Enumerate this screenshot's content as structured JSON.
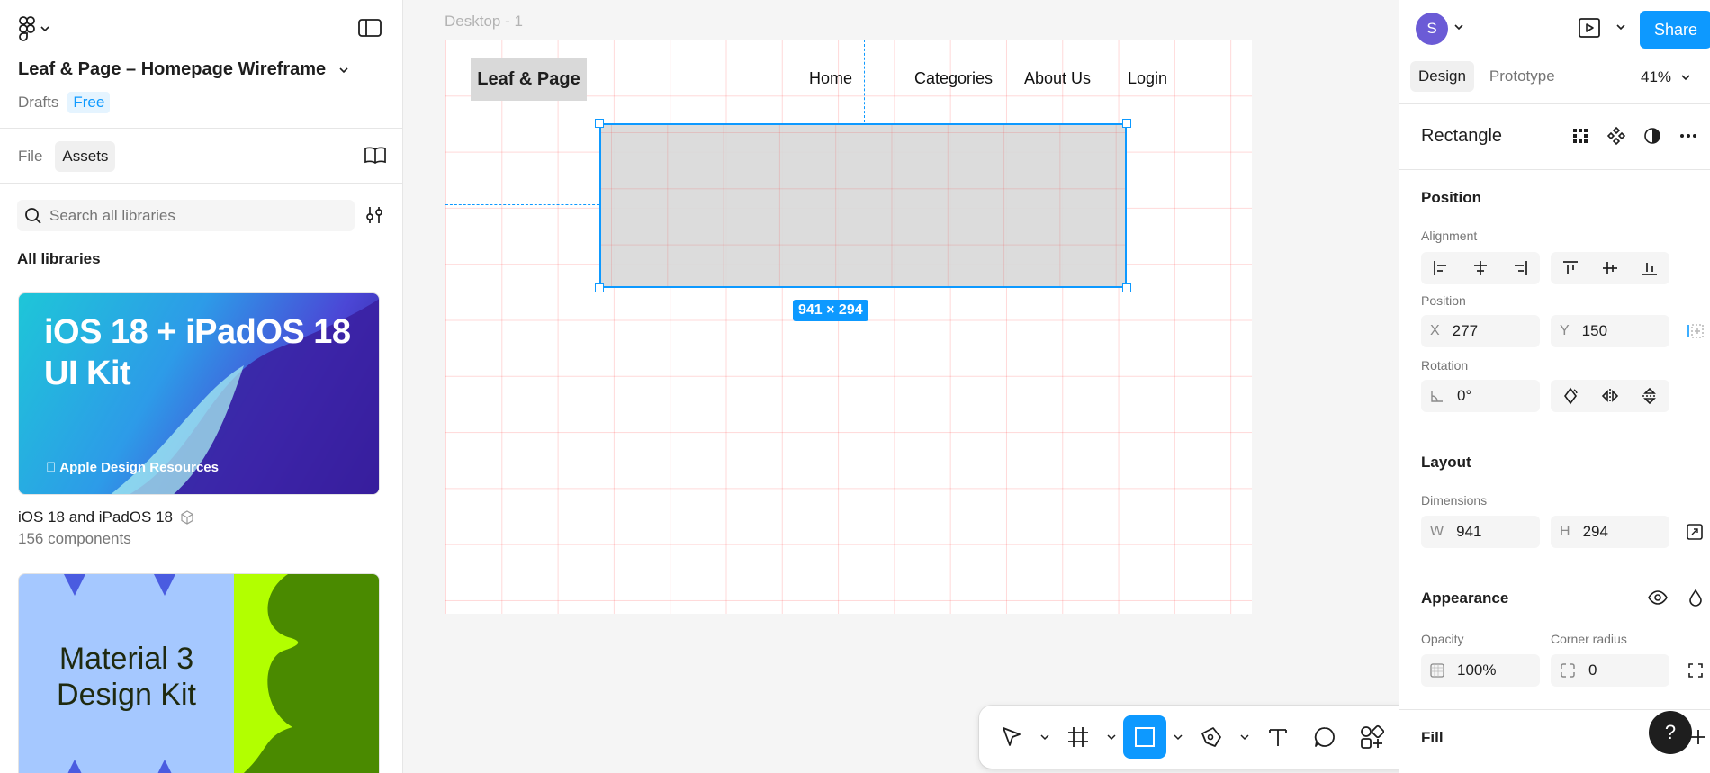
{
  "left_panel": {
    "file_title": "Leaf & Page – Homepage Wireframe",
    "drafts_label": "Drafts",
    "plan_badge": "Free",
    "tabs": [
      {
        "label": "File"
      },
      {
        "label": "Assets"
      }
    ],
    "search_placeholder": "Search all libraries",
    "all_libraries_label": "All libraries",
    "libraries": [
      {
        "thumb_title": "iOS 18 + iPadOS 18 UI Kit",
        "thumb_brand": "Apple Design Resources",
        "name": "iOS 18 and iPadOS 18",
        "count": "156 components"
      },
      {
        "thumb_title": "Material 3 Design Kit"
      }
    ]
  },
  "canvas": {
    "frame_label": "Desktop - 1",
    "brand_text": "Leaf & Page",
    "nav": [
      "Home",
      "Categories",
      "About Us",
      "Login"
    ],
    "selection_size": "941 × 294"
  },
  "toolbar": {
    "active_tool": "rectangle"
  },
  "right_panel": {
    "avatar_initial": "S",
    "share_label": "Share",
    "tabs": [
      {
        "label": "Design"
      },
      {
        "label": "Prototype"
      }
    ],
    "zoom": "41%",
    "layer_name": "Rectangle",
    "position_section": "Position",
    "alignment_label": "Alignment",
    "position_label": "Position",
    "x_label": "X",
    "x_value": "277",
    "y_label": "Y",
    "y_value": "150",
    "rotation_label": "Rotation",
    "rotation_value": "0°",
    "layout_section": "Layout",
    "dimensions_label": "Dimensions",
    "w_label": "W",
    "w_value": "941",
    "h_label": "H",
    "h_value": "294",
    "appearance_section": "Appearance",
    "opacity_label": "Opacity",
    "opacity_value": "100%",
    "corner_radius_label": "Corner radius",
    "corner_radius_value": "0",
    "fill_section": "Fill",
    "help_label": "?"
  },
  "colors": {
    "accent": "#0d99ff",
    "rect_fill": "#d9d9d9",
    "brand_box": "#d9d9d9"
  }
}
